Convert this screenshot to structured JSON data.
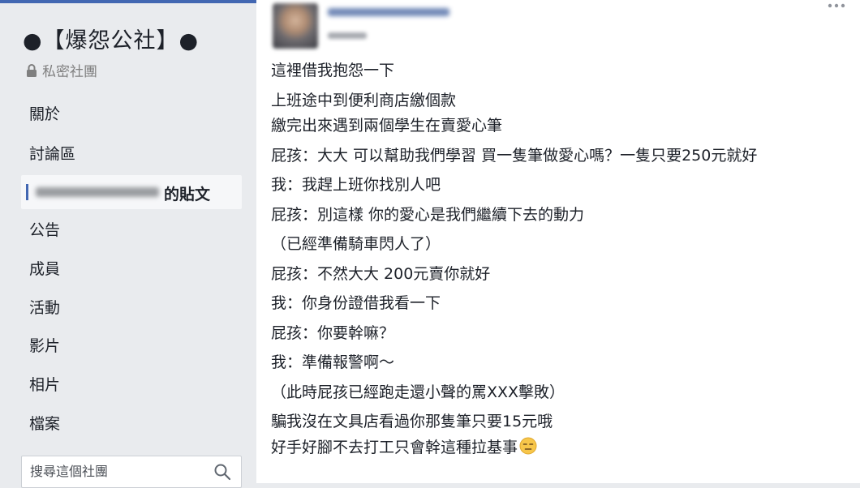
{
  "group": {
    "title": "●【爆怨公社】●",
    "privacy_label": "私密社團"
  },
  "nav": {
    "about": "關於",
    "discussion": "討論區",
    "member_posts_suffix": "的貼文",
    "announcements": "公告",
    "members": "成員",
    "events": "活動",
    "videos": "影片",
    "photos": "相片",
    "files": "檔案"
  },
  "search": {
    "placeholder": "搜尋這個社團"
  },
  "post": {
    "lines": [
      "這裡借我抱怨一下",
      "上班途中到便利商店繳個款",
      "繳完出來遇到兩個學生在賣愛心筆",
      "屁孩：大大 可以幫助我們學習 買一隻筆做愛心嗎？一隻只要250元就好",
      "我：我趕上班你找別人吧",
      "屁孩：別這樣 你的愛心是我們繼續下去的動力",
      "（已經準備騎車閃人了）",
      "屁孩：不然大大 200元賣你就好",
      "我：你身份證借我看一下",
      "屁孩：你要幹嘛？",
      "我：準備報警啊～",
      "（此時屁孩已經跑走還小聲的罵XXX擊敗）",
      "騙我沒在文具店看過你那隻筆只要15元哦",
      "好手好腳不去打工只會幹這種拉基事"
    ]
  },
  "icons": {
    "lock": "lock-icon",
    "search": "search-icon",
    "more": "more-icon",
    "emoji": "expressionless-face-emoji"
  },
  "colors": {
    "brand": "#4267b2",
    "sidebar_bg": "#e9ebee",
    "active_item_bg": "#f6f7f9",
    "text": "#1d2129",
    "muted": "#7f7f7f"
  }
}
